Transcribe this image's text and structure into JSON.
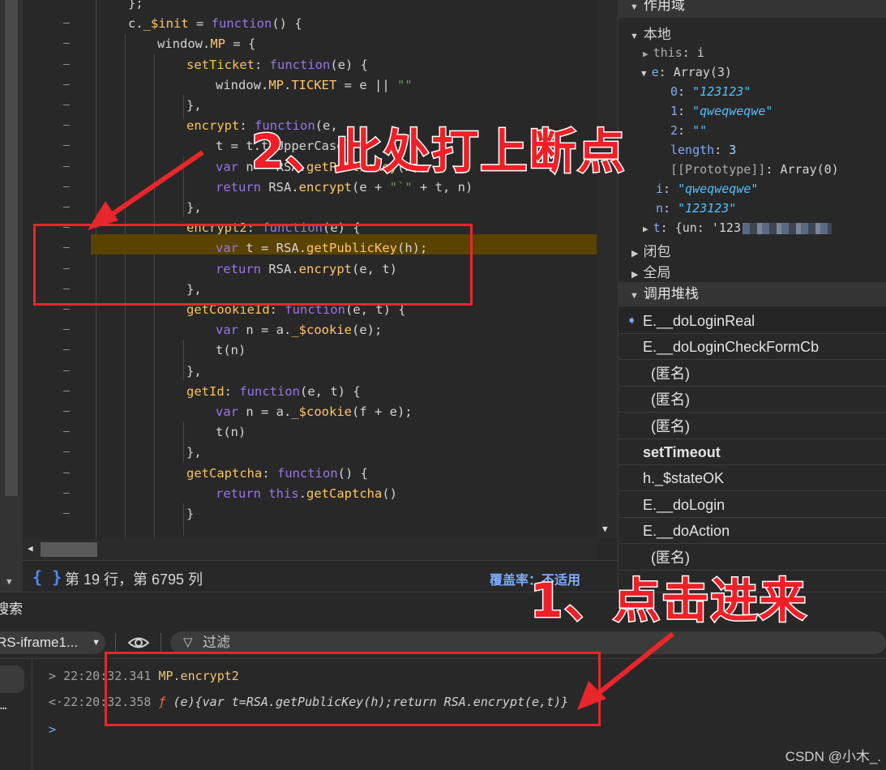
{
  "editor": {
    "lines": [
      {
        "text": "};"
      },
      {
        "text": "c._$init = function() {"
      },
      {
        "text": "window.MP = {"
      },
      {
        "text": "setTicket: function(e) {"
      },
      {
        "text": "window.MP.TICKET = e || \"\""
      },
      {
        "text": "},"
      },
      {
        "text": "encrypt: function(e,"
      },
      {
        "text": "t = t.toUpperCase"
      },
      {
        "text": "var n = RSA.getPublicKey(h);"
      },
      {
        "text": "return RSA.encrypt(e + \"`\" + t, n)"
      },
      {
        "text": "},"
      },
      {
        "text": "encrypt2: function(e) {"
      },
      {
        "text": "var t = RSA.getPublicKey(h);"
      },
      {
        "text": "return RSA.encrypt(e, t)"
      },
      {
        "text": "},"
      },
      {
        "text": "getCookieId: function(e, t) {"
      },
      {
        "text": "var n = a._$cookie(e);"
      },
      {
        "text": "t(n)"
      },
      {
        "text": "},"
      },
      {
        "text": "getId: function(e, t) {"
      },
      {
        "text": "var n = a._$cookie(f + e);"
      },
      {
        "text": "t(n)"
      },
      {
        "text": "},"
      },
      {
        "text": "getCaptcha: function() {"
      },
      {
        "text": "return this.getCaptcha()"
      },
      {
        "text": "}"
      }
    ],
    "gutter_mark": "–",
    "status": {
      "braces": "{ }",
      "position": "第 19 行，第 6795 列",
      "coverage": "覆盖率：不适用"
    }
  },
  "scope": {
    "header": "作用域",
    "local_header": "本地",
    "this_key": "this",
    "this_val": "i",
    "e_key": "e",
    "e_val": "Array(3)",
    "e0_key": "0",
    "e0_val": "\"123123\"",
    "e1_key": "1",
    "e1_val": "\"qweqweqwe\"",
    "e2_key": "2",
    "e2_val": "\"\"",
    "len_key": "length",
    "len_val": "3",
    "proto_key": "[[Prototype]]",
    "proto_val": "Array(0)",
    "i_key": "i",
    "i_val": "\"qweqweqwe\"",
    "n_key": "n",
    "n_val": "\"123123\"",
    "t_key": "t",
    "t_val": "{un: '123",
    "closure": "闭包",
    "global": "全局"
  },
  "callstack": {
    "header": "调用堆栈",
    "items": [
      "E.__doLoginReal",
      "E.__doLoginCheckFormCb",
      "(匿名)",
      "(匿名)",
      "(匿名)",
      "setTimeout",
      "h._$stateOK",
      "E.__doLogin",
      "E.__doAction",
      "(匿名)"
    ]
  },
  "console": {
    "drawer_tab": "搜索",
    "context": "RS-iframe1...",
    "filter_label": "过滤",
    "entries": [
      {
        "marker": ">",
        "time": "22:20:32.341",
        "code": "MP.encrypt2"
      },
      {
        "marker": "<·",
        "time": "22:20:32.358",
        "fn": "ƒ",
        "code": "(e){var t=RSA.getPublicKey(h);return RSA.encrypt(e,t)}"
      }
    ],
    "prompt": ">"
  },
  "annotations": {
    "step2": "2、此处打上断点",
    "step1": "1、点击进来"
  },
  "watermark": "CSDN @小木_.",
  "colors": {
    "annotation_red": "#e8262c",
    "breakpoint_highlight": "#5a4300",
    "accent_blue": "#7cacf8"
  }
}
